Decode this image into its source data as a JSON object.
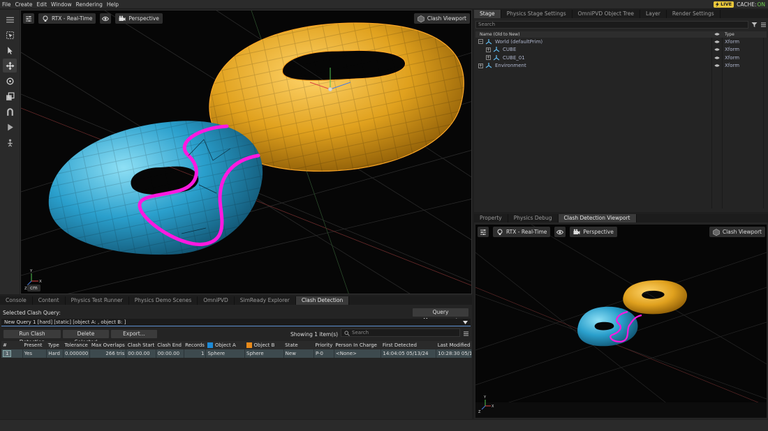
{
  "menu": [
    "File",
    "Create",
    "Edit",
    "Window",
    "Rendering",
    "Help"
  ],
  "status_right": {
    "live": "LIVE",
    "cache_label": "CACHE:",
    "cache_state": "ON"
  },
  "left_tools": [
    "menu-icon",
    "select-region-icon",
    "select-arrow-icon",
    "move-icon",
    "rotate-icon",
    "scale-icon",
    "magnet-icon",
    "play-icon",
    "physics-icon"
  ],
  "viewport": {
    "render_mode": "RTX - Real-Time",
    "camera": "Perspective",
    "clash_viewport": "Clash Viewport",
    "unit": "cm",
    "axes": {
      "y": "Y",
      "z": "Z",
      "x": "X"
    }
  },
  "stage": {
    "tabs": [
      "Stage",
      "Physics Stage Settings",
      "OmniPVD Object Tree",
      "Layer",
      "Render Settings"
    ],
    "search_placeholder": "Search",
    "columns": {
      "name": "Name (Old to New)",
      "type": "Type"
    },
    "rows": [
      {
        "name": "World (defaultPrim)",
        "type": "Xform"
      },
      {
        "name": "CUBE",
        "type": "Xform"
      },
      {
        "name": "CUBE_01",
        "type": "Xform"
      },
      {
        "name": "Environment",
        "type": "Xform"
      }
    ]
  },
  "clash_panel": {
    "tabs": [
      "Property",
      "Physics Debug",
      "Clash Detection Viewport"
    ],
    "render_mode": "RTX - Real-Time",
    "camera": "Perspective",
    "clash_viewport": "Clash Viewport"
  },
  "bottom": {
    "tabs": [
      "Console",
      "Content",
      "Physics Test Runner",
      "Physics Demo Scenes",
      "OmniPVD",
      "SimReady Explorer",
      "Clash Detection"
    ],
    "selected_query_label": "Selected Clash Query:",
    "query_management": "Query Management",
    "query_value": "New Query 1 [hard] [static] [object A: , object B: ]",
    "buttons": {
      "run": "Run Clash Detection",
      "delete": "Delete Selected",
      "export": "Export..."
    },
    "showing": "Showing 1 item(s)",
    "search_placeholder": "Search",
    "columns": [
      "#",
      "Present",
      "Type",
      "Tolerance",
      "Max Overlaps",
      "Clash Start",
      "Clash End",
      "Records",
      "Object A",
      "Object B",
      "State",
      "Priority",
      "Person In Charge",
      "First Detected",
      "Last Modified"
    ],
    "rows": [
      [
        "1",
        "Yes",
        "Hard",
        "0.000000",
        "266  tris",
        "00:00.00",
        "00:00.00",
        "1",
        "Sphere",
        "Sphere",
        "New",
        "P-0",
        "<None>",
        "14:04:05 05/13/24",
        "10:28:30 05/15/"
      ]
    ]
  },
  "colors": {
    "accent_blue": "#5c8fcf",
    "object_a": "#1d8ad6",
    "object_b": "#e88a1a",
    "torus_gold": "#e3a21c",
    "torus_blue": "#2c9cc6",
    "clash_magenta": "#ff19e0"
  }
}
